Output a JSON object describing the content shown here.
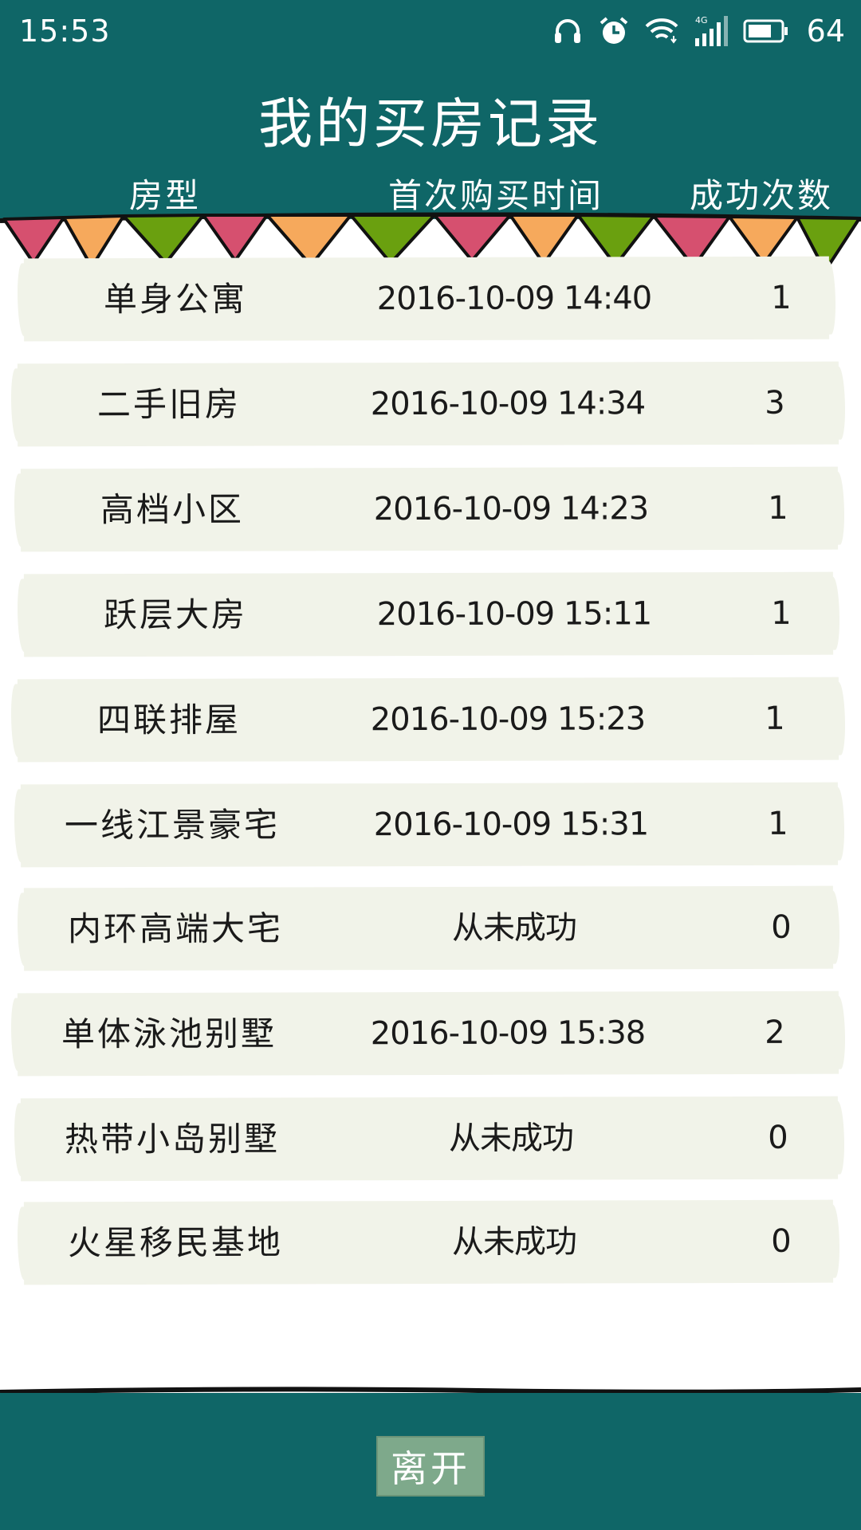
{
  "status_bar": {
    "time": "15:53",
    "network": "4G",
    "battery": "64",
    "icons": [
      "headphones-icon",
      "alarm-icon",
      "wifi-icon",
      "signal-icon",
      "battery-icon"
    ]
  },
  "title": "我的买房记录",
  "columns": [
    "房型",
    "首次购买时间",
    "成功次数"
  ],
  "rows": [
    {
      "type": "单身公寓",
      "time": "2016-10-09 14:40",
      "count": "1"
    },
    {
      "type": "二手旧房",
      "time": "2016-10-09 14:34",
      "count": "3"
    },
    {
      "type": "高档小区",
      "time": "2016-10-09 14:23",
      "count": "1"
    },
    {
      "type": "跃层大房",
      "time": "2016-10-09 15:11",
      "count": "1"
    },
    {
      "type": "四联排屋",
      "time": "2016-10-09 15:23",
      "count": "1"
    },
    {
      "type": "一线江景豪宅",
      "time": "2016-10-09 15:31",
      "count": "1"
    },
    {
      "type": "内环高端大宅",
      "time": "从未成功",
      "count": "0"
    },
    {
      "type": "单体泳池别墅",
      "time": "2016-10-09 15:38",
      "count": "2"
    },
    {
      "type": "热带小岛别墅",
      "time": "从未成功",
      "count": "0"
    },
    {
      "type": "火星移民基地",
      "time": "从未成功",
      "count": "0"
    }
  ],
  "leave_button": "离开",
  "colors": {
    "header": "#0f6667",
    "row_bg": "#f1f3e9",
    "flag_pink": "#d6506f",
    "flag_orange": "#f6a95c",
    "flag_green": "#6aa00f",
    "button": "#7ea98b"
  }
}
